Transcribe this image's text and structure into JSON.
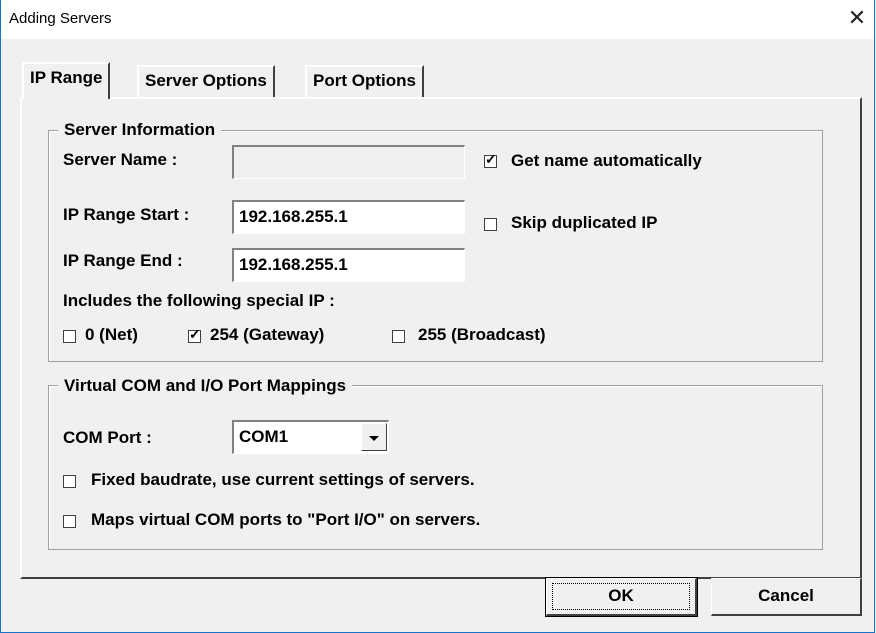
{
  "window": {
    "title": "Adding Servers"
  },
  "tabs": [
    "IP Range",
    "Server Options",
    "Port Options"
  ],
  "server_info": {
    "group_label": "Server Information",
    "server_name_label": "Server Name :",
    "server_name_value": "",
    "get_name_label": "Get name automatically",
    "get_name_checked": true,
    "ip_start_label": "IP Range Start :",
    "ip_start_value": "192.168.255.1",
    "skip_dup_label": "Skip duplicated IP",
    "skip_dup_checked": false,
    "ip_end_label": "IP Range End :",
    "ip_end_value": "192.168.255.1",
    "special_ip_label": "Includes the following special IP :",
    "special": [
      {
        "label": "0 (Net)",
        "checked": false
      },
      {
        "label": "254 (Gateway)",
        "checked": true
      },
      {
        "label": "255 (Broadcast)",
        "checked": false
      }
    ]
  },
  "mapping": {
    "group_label": "Virtual COM and I/O Port Mappings",
    "com_port_label": "COM Port :",
    "com_port_value": "COM1",
    "fixed_baud_label": "Fixed baudrate, use current settings of servers.",
    "fixed_baud_checked": false,
    "maps_io_label": "Maps virtual COM ports to \"Port I/O\" on servers.",
    "maps_io_checked": false
  },
  "buttons": {
    "ok": "OK",
    "cancel": "Cancel"
  },
  "icons": {
    "close": "close-icon",
    "check": "check-icon",
    "dropdown": "chevron-down-icon"
  }
}
